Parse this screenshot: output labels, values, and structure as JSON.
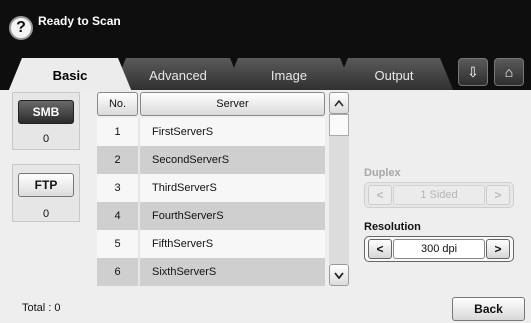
{
  "header": {
    "help_icon": "?",
    "title": "Ready to Scan"
  },
  "tabs": [
    {
      "label": "Basic",
      "active": true
    },
    {
      "label": "Advanced",
      "active": false
    },
    {
      "label": "Image",
      "active": false
    },
    {
      "label": "Output",
      "active": false
    }
  ],
  "tab_icons": {
    "scan_to_icon": "⇩",
    "home_icon": "⌂"
  },
  "protocols": {
    "smb": {
      "label": "SMB",
      "count": "0",
      "selected": true
    },
    "ftp": {
      "label": "FTP",
      "count": "0",
      "selected": false
    }
  },
  "table": {
    "headers": {
      "no": "No.",
      "server": "Server"
    },
    "rows": [
      {
        "no": "1",
        "server": "FirstServerS"
      },
      {
        "no": "2",
        "server": "SecondServerS"
      },
      {
        "no": "3",
        "server": "ThirdServerS"
      },
      {
        "no": "4",
        "server": "FourthServerS"
      },
      {
        "no": "5",
        "server": "FifthServerS"
      },
      {
        "no": "6",
        "server": "SixthServerS"
      }
    ],
    "scroll_up": "^",
    "scroll_down": "v"
  },
  "duplex": {
    "label": "Duplex",
    "value": "1 Sided",
    "prev": "<",
    "next": ">",
    "enabled": false
  },
  "resolution": {
    "label": "Resolution",
    "value": "300 dpi",
    "prev": "<",
    "next": ">",
    "enabled": true
  },
  "footer": {
    "total": "Total : 0",
    "back_label": "Back"
  },
  "colors": {
    "header_bg": "#0e0e0e",
    "selected_button": "#3a3a3a",
    "row_dark": "#cfcfcf",
    "row_light": "#f7f7f7"
  }
}
